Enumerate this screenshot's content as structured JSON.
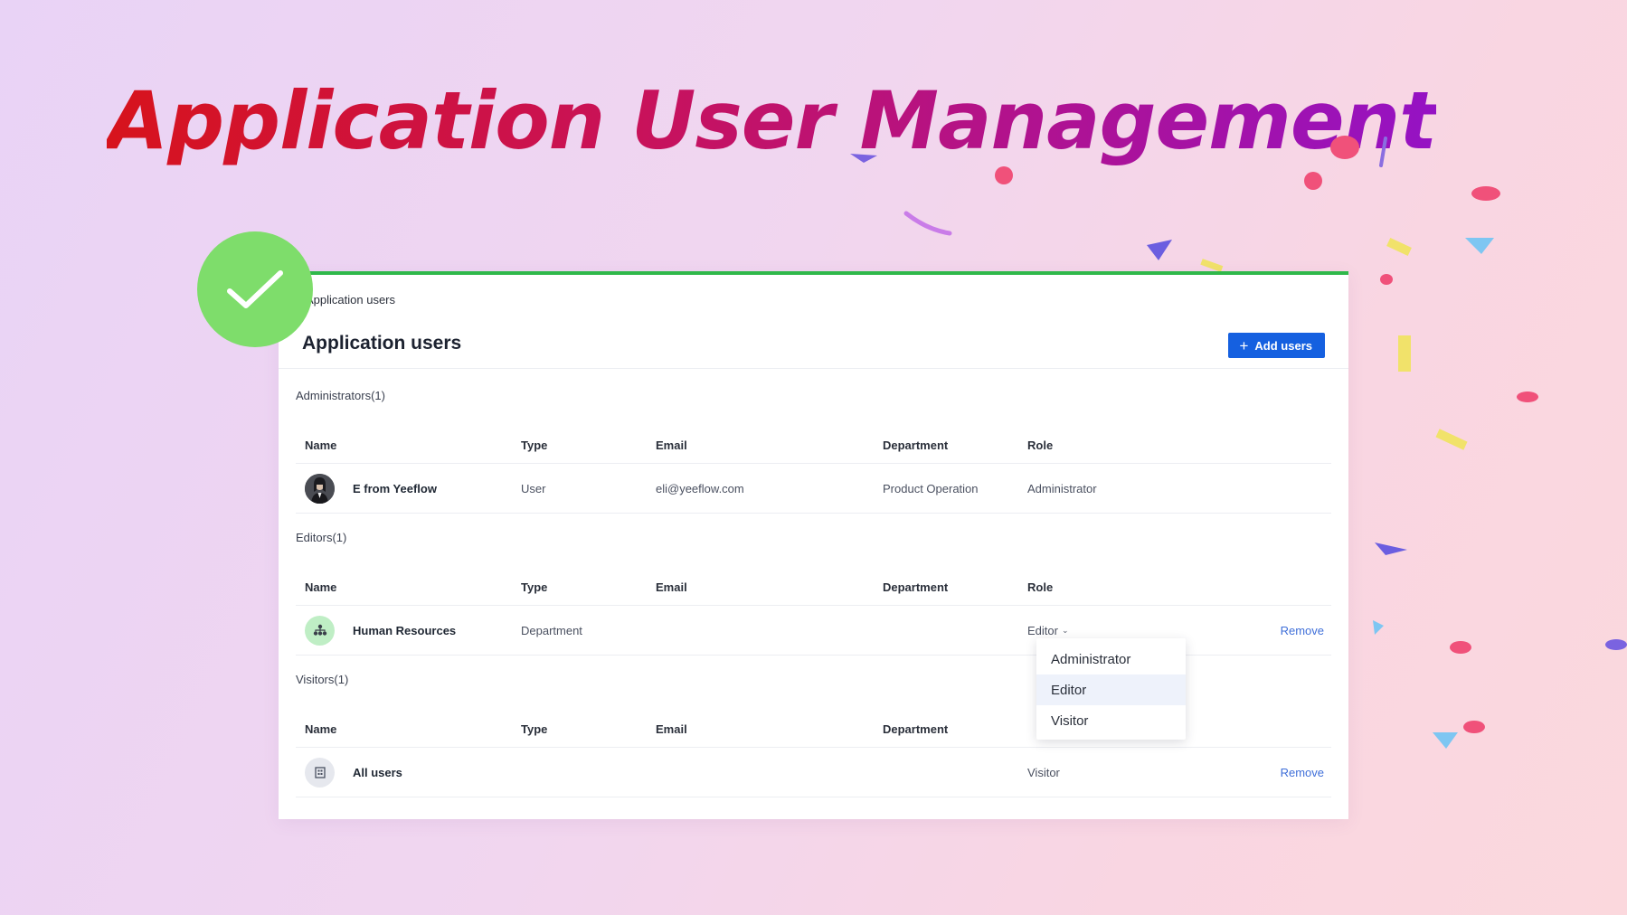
{
  "hero": {
    "title": "Application User Management"
  },
  "breadcrumb": "Application users",
  "page_title": "Application users",
  "add_users_label": "Add users",
  "columns": {
    "name": "Name",
    "type": "Type",
    "email": "Email",
    "department": "Department",
    "role": "Role"
  },
  "sections": {
    "administrators": {
      "label": "Administrators(1)",
      "rows": [
        {
          "name": "E from Yeeflow",
          "type": "User",
          "email": "eli@yeeflow.com",
          "department": "Product Operation",
          "role": "Administrator"
        }
      ]
    },
    "editors": {
      "label": "Editors(1)",
      "rows": [
        {
          "name": "Human Resources",
          "type": "Department",
          "email": "",
          "department": "",
          "role": "Editor",
          "action": "Remove"
        }
      ]
    },
    "visitors": {
      "label": "Visitors(1)",
      "rows": [
        {
          "name": "All users",
          "type": "",
          "email": "",
          "department": "",
          "role": "Visitor",
          "action": "Remove"
        }
      ]
    }
  },
  "role_dropdown": {
    "options": [
      "Administrator",
      "Editor",
      "Visitor"
    ],
    "selected": "Editor"
  },
  "colors": {
    "primary": "#1560e0",
    "success": "#7edd6b",
    "panel_accent": "#2fb84a",
    "link": "#3f6fd9"
  }
}
